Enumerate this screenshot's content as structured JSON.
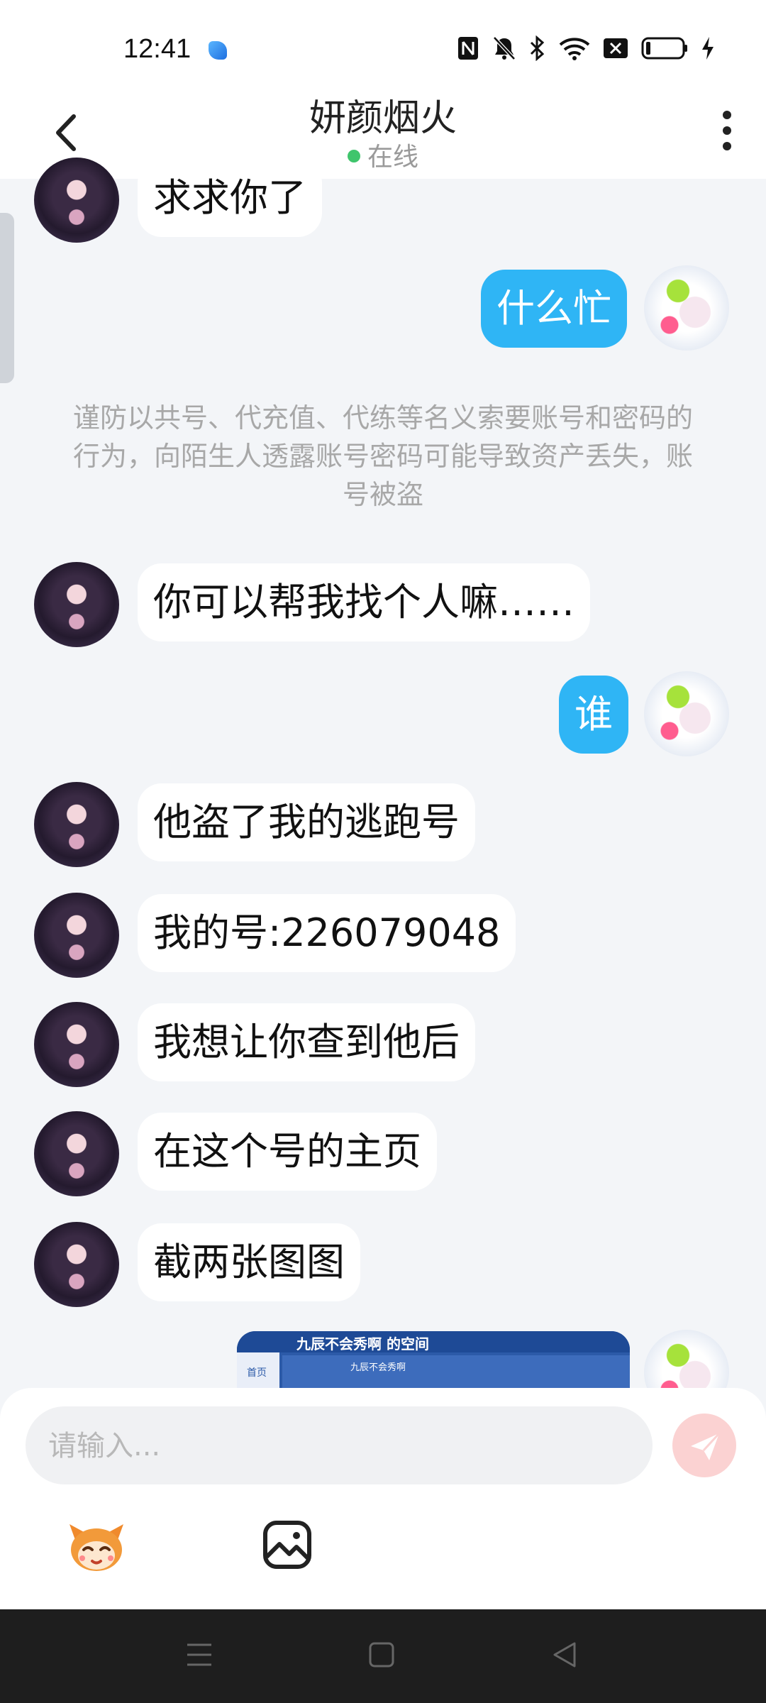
{
  "status_bar": {
    "time": "12:41",
    "icons": [
      "app-icon",
      "nfc-icon",
      "bell-off-icon",
      "bluetooth-icon",
      "wifi-icon",
      "data-off-icon",
      "battery-icon",
      "charging-icon"
    ]
  },
  "header": {
    "title": "妍颜烟火",
    "status": "在线",
    "status_color": "#3fc56c"
  },
  "warning": "谨防以共号、代充值、代练等名义索要账号和密码的行为，向陌生人透露账号密码可能导致资产丢失，账号被盗",
  "messages": [
    {
      "side": "in",
      "text": "求求你了"
    },
    {
      "side": "out",
      "text": "什么忙"
    },
    {
      "side": "in",
      "text": "你可以帮我找个人嘛……"
    },
    {
      "side": "out",
      "text": "谁"
    },
    {
      "side": "in",
      "text": "他盗了我的逃跑号"
    },
    {
      "side": "in",
      "text": "我的号:226079048"
    },
    {
      "side": "in",
      "text": "我想让你查到他后"
    },
    {
      "side": "in",
      "text": "在这个号的主页"
    },
    {
      "side": "in",
      "text": "截两张图图"
    }
  ],
  "image_message": {
    "title": "九辰不会秀啊 的空间",
    "home_label": "首页",
    "name": "九辰不会秀啊"
  },
  "input": {
    "placeholder": "请输入...",
    "value": ""
  },
  "colors": {
    "outgoing_bubble": "#2fb5f5",
    "incoming_bubble": "#ffffff",
    "background": "#f3f5f8",
    "send_button": "#fbd2d2"
  }
}
